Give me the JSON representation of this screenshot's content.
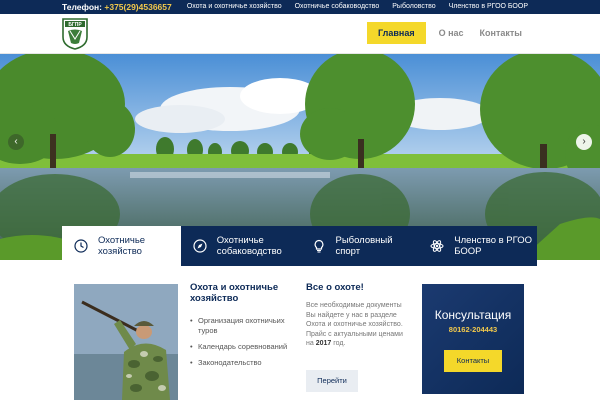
{
  "topbar": {
    "phone_label": "Телефон:",
    "phone_number": "+375(29)4536657",
    "links": [
      "Охота и охотничье хозяйство",
      "Охотничье собаководство",
      "Рыболовство",
      "Членство в РГОО БООР"
    ]
  },
  "header": {
    "logo_text": "БГПР",
    "nav": [
      {
        "label": "Главная",
        "active": true
      },
      {
        "label": "О нас",
        "active": false
      },
      {
        "label": "Контакты",
        "active": false
      }
    ]
  },
  "hero": {
    "prev_arrow": "‹",
    "next_arrow": "›"
  },
  "tabs": [
    {
      "label": "Охотничье\nхозяйство",
      "icon": "clock-icon",
      "active": true
    },
    {
      "label": "Охотничье\nсобаководство",
      "icon": "compass-icon",
      "active": false
    },
    {
      "label": "Рыболовный\nспорт",
      "icon": "lightbulb-icon",
      "active": false
    },
    {
      "label": "Членство в РГОО\nБООР",
      "icon": "atom-icon",
      "active": false
    }
  ],
  "content": {
    "col2": {
      "title": "Охота и охотничье хозяйство",
      "items": [
        "Организация охотничьих туров",
        "Календарь соревнований",
        "Законодательство"
      ]
    },
    "col3": {
      "title": "Все о охоте!",
      "text_before": "Все необходимые документы Вы найдете у нас в разделе Охота и охотничье хозяйство. Прайс с актуальными ценами на ",
      "year": "2017",
      "text_after": " год.",
      "button": "Перейти"
    },
    "consult": {
      "title": "Консультация",
      "phone": "80162-204443",
      "button": "Контакты"
    }
  },
  "colors": {
    "navy": "#0d2a57",
    "accent_yellow": "#f4d82a",
    "phone_yellow": "#f2c94c"
  }
}
